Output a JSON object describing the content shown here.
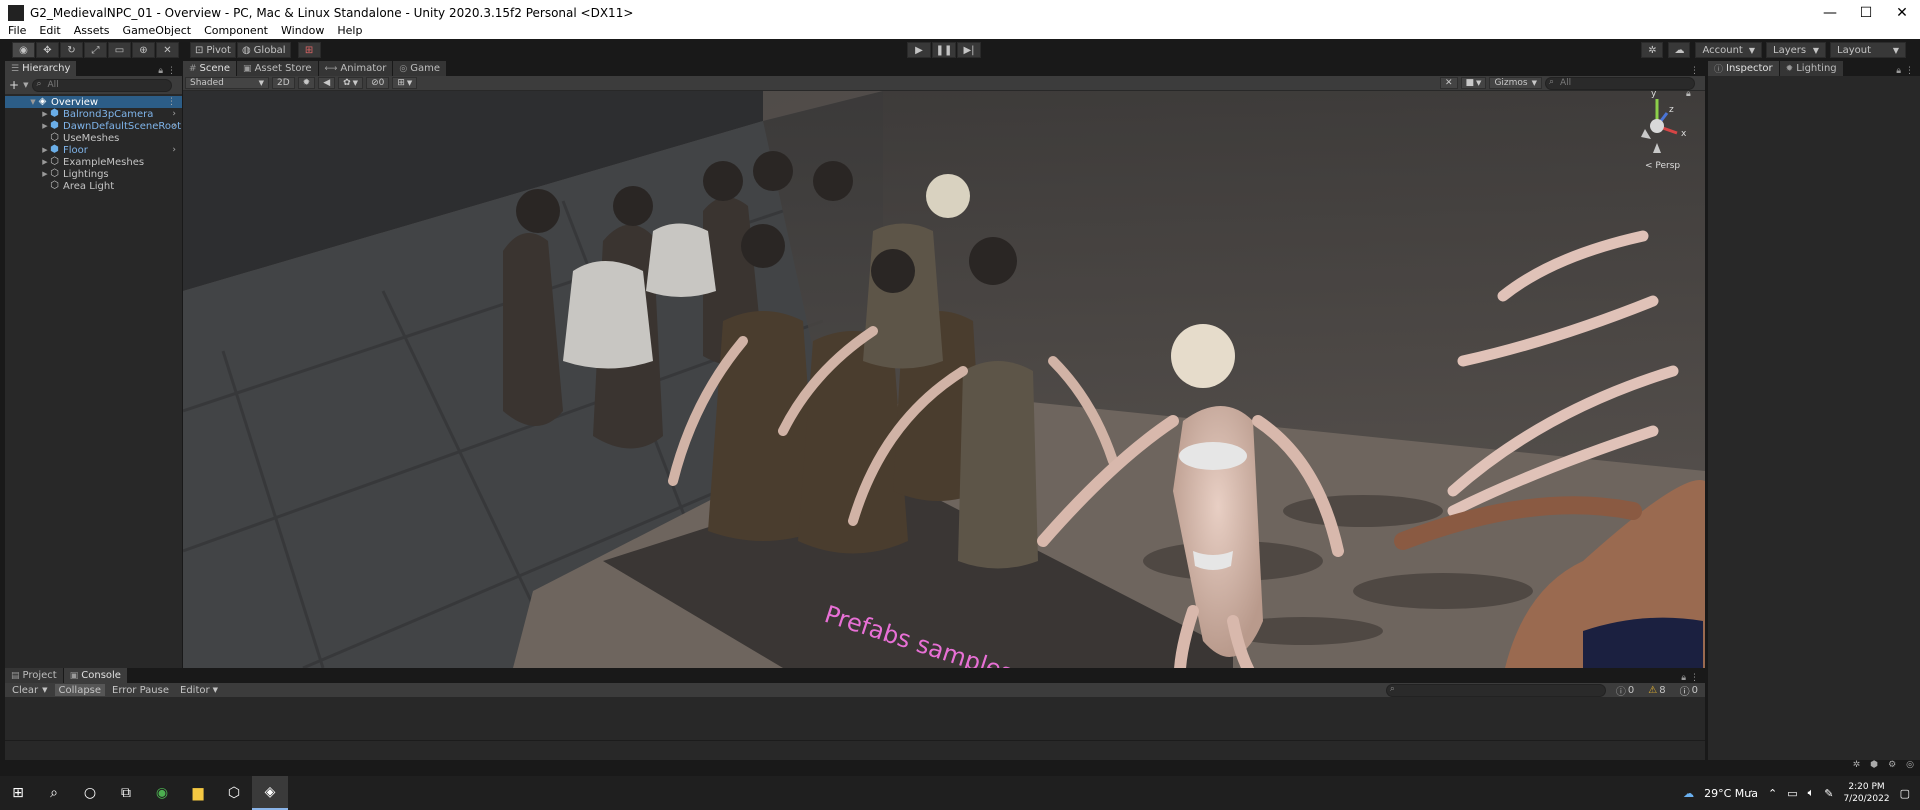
{
  "window": {
    "title": "G2_MedievalNPC_01 - Overview - PC, Mac & Linux Standalone - Unity 2020.3.15f2 Personal <DX11>",
    "minimize": "—",
    "maximize": "☐",
    "close": "✕"
  },
  "menu": [
    "File",
    "Edit",
    "Assets",
    "GameObject",
    "Component",
    "Window",
    "Help"
  ],
  "toolbar": {
    "pivot": "Pivot",
    "global": "Global",
    "account": "Account",
    "layers": "Layers",
    "layout": "Layout"
  },
  "hierarchy": {
    "tab": "Hierarchy",
    "add": "+",
    "search_placeholder": "All",
    "scene_root": "Overview",
    "items": [
      {
        "label": "Balrond3pCamera",
        "prefab": true,
        "arrow": true
      },
      {
        "label": "DawnDefaultSceneRoot",
        "prefab": true,
        "arrow": true
      },
      {
        "label": "UseMeshes",
        "prefab": false
      },
      {
        "label": "Floor",
        "prefab": true,
        "arrow": true
      },
      {
        "label": "ExampleMeshes",
        "prefab": false
      },
      {
        "label": "Lightings",
        "prefab": false
      },
      {
        "label": "Area Light",
        "prefab": false
      }
    ]
  },
  "scene_tabs": {
    "scene": "Scene",
    "asset_store": "Asset Store",
    "animator": "Animator",
    "game": "Game"
  },
  "scene_toolbar": {
    "shading": "Shaded",
    "mode_2d": "2D",
    "hidden_count": "0",
    "gizmos": "Gizmos",
    "search_placeholder": "All"
  },
  "viewport": {
    "gizmo_y": "y",
    "gizmo_z": "z",
    "gizmo_x": "x",
    "projection": "< Persp",
    "floor_text": "Prefabs samples"
  },
  "inspector": {
    "tab": "Inspector",
    "lighting_tab": "Lighting"
  },
  "console": {
    "project_tab": "Project",
    "console_tab": "Console",
    "clear": "Clear",
    "collapse": "Collapse",
    "error_pause": "Error Pause",
    "editor": "Editor",
    "log_count": "0",
    "warning_count": "8",
    "error_count": "0"
  },
  "taskbar": {
    "weather": "29°C Mưa",
    "time": "2:20 PM",
    "date": "7/20/2022"
  }
}
